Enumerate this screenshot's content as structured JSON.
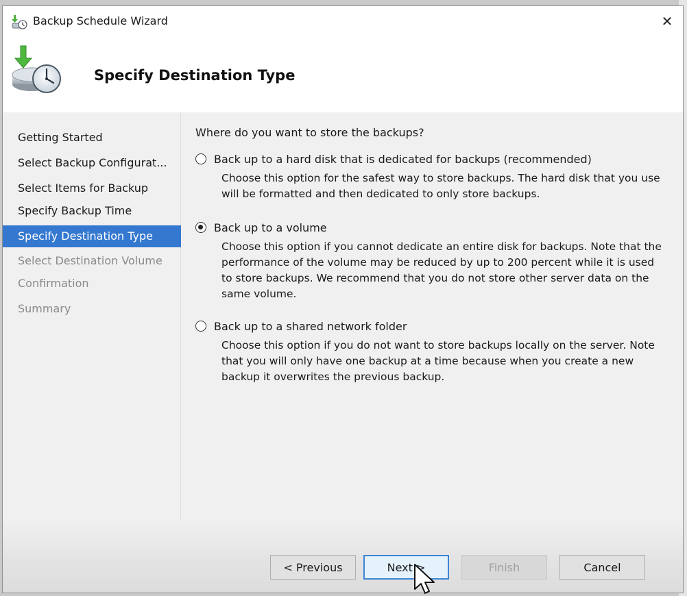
{
  "window": {
    "title": "Backup Schedule Wizard",
    "close_glyph": "✕"
  },
  "header": {
    "title": "Specify Destination Type"
  },
  "nav": {
    "items": [
      {
        "label": "Getting Started",
        "state": "normal"
      },
      {
        "label": "Select Backup Configurat...",
        "state": "normal"
      },
      {
        "label": "Select Items for Backup",
        "state": "normal"
      },
      {
        "label": "Specify Backup Time",
        "state": "normal"
      },
      {
        "label": "Specify Destination Type",
        "state": "active"
      },
      {
        "label": "Select Destination Volume",
        "state": "disabled"
      },
      {
        "label": "Confirmation",
        "state": "disabled"
      },
      {
        "label": "Summary",
        "state": "disabled"
      }
    ]
  },
  "content": {
    "question": "Where do you want to store the backups?",
    "options": [
      {
        "label": "Back up to a hard disk that is dedicated for backups (recommended)",
        "description_lines": [
          "Choose this option for the safest way to store backups. The hard disk that you use",
          "will be formatted and then dedicated to only store backups."
        ],
        "checked": false
      },
      {
        "label": "Back up to a volume",
        "description_lines": [
          "Choose this option if you cannot dedicate an entire disk for backups. Note that the",
          "performance of the volume may be reduced by up to 200 percent while it is used",
          "to store backups. We recommend that you do not store other server data on the",
          "same volume."
        ],
        "checked": true
      },
      {
        "label": "Back up to a shared network folder",
        "description_lines": [
          "Choose this option if you do not want to store backups locally on the server. Note",
          "that you will only have one backup at a time because when you create a new",
          "backup it overwrites the previous backup."
        ],
        "checked": false
      }
    ]
  },
  "buttons": {
    "previous": "< Previous",
    "next": "Next >",
    "finish": "Finish",
    "cancel": "Cancel"
  },
  "colors": {
    "selection": "#3478d0",
    "primary_border": "#3c84d6"
  }
}
